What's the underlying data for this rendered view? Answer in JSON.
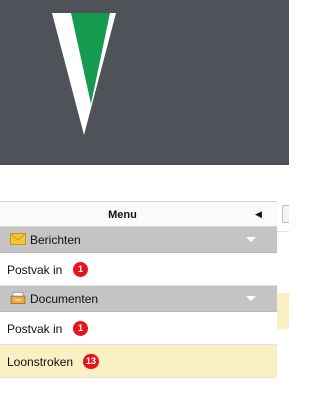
{
  "brand": {
    "logo_icon": "green-v-logo-icon",
    "colors": {
      "header_bg": "#4f5359",
      "logo_green": "#159a4f",
      "logo_white": "#ffffff"
    }
  },
  "menu": {
    "title": "Menu",
    "collapse_icon": "triangle-left-icon",
    "sections": [
      {
        "label": "Berichten",
        "icon": "envelope-icon",
        "items": [
          {
            "label": "Postvak in",
            "badge": "1",
            "selected": false
          }
        ]
      },
      {
        "label": "Documenten",
        "icon": "documents-icon",
        "items": [
          {
            "label": "Postvak in",
            "badge": "1",
            "selected": false
          },
          {
            "label": "Loonstroken",
            "badge": "13",
            "selected": true
          }
        ]
      }
    ]
  },
  "colors": {
    "badge": "#e8141b",
    "selected_row": "#fbefc4",
    "section_bg": "#c4c4c4"
  }
}
